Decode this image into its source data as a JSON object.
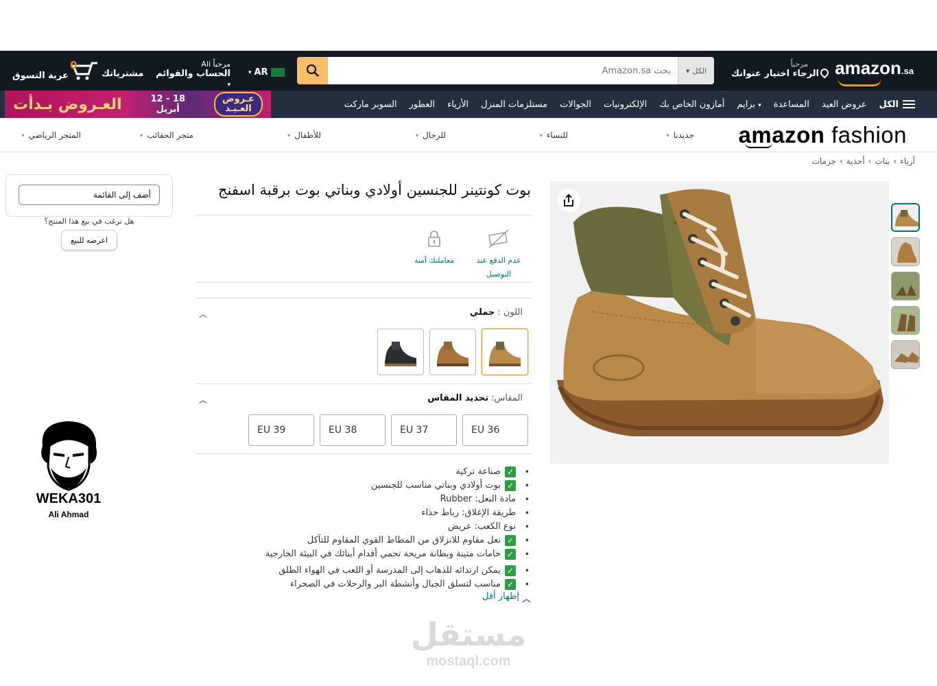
{
  "header": {
    "logo_text": "amazon",
    "logo_suffix": ".sa",
    "deliver_line1": "مرحباً",
    "deliver_line2": "الرجاء اختيار عنوانك",
    "search_category": "الكل",
    "search_placeholder": "بحث Amazon.sa",
    "language": "AR",
    "account_line1": "مرحباً Ali",
    "account_line2": "الحساب والقوائم",
    "orders": "مشترياتك",
    "cart_count": "0",
    "cart_label": "عربة التسوق"
  },
  "nav": {
    "all": "الكل",
    "items": [
      "عروض العيد",
      "المساعدة",
      "برايم",
      "أمازون الخاص بك",
      "الإلكترونيات",
      "الجوالات",
      "مستلزمات المنزل",
      "الأزياء",
      "العطور",
      "السوبر ماركت"
    ],
    "promo_badge_line1": "عـروض",
    "promo_badge_line2": "العـيـد",
    "promo_dates_line1": "12 - 18",
    "promo_dates_line2": "أبريل",
    "promo_title": "العـروض بـدأت"
  },
  "fashion": {
    "logo_bold": "amazon",
    "logo_rest": " fashion",
    "menu": [
      "جديدنا",
      "للنساء",
      "للرجال",
      "للأطفال",
      "متجر الحقائب",
      "المتجر الرياضي"
    ]
  },
  "breadcrumb": [
    "أزياء",
    "›",
    "بنات",
    "›",
    "أحذية",
    "›",
    "جزمات"
  ],
  "product": {
    "title": "بوت كونتينر للجنسين أولادي وبناتي بوت برقبة اسفنج",
    "features": [
      {
        "label": "عدم الدفع عند التوصيل",
        "icon": "no-cash-icon"
      },
      {
        "label": "معاملتك آمنة",
        "icon": "lock-icon"
      }
    ],
    "color_key": "اللون :",
    "color_value": "جملي",
    "swatches": [
      "camel",
      "brown",
      "black"
    ],
    "size_key": "المقاس:",
    "size_value": "تحديد المقاس",
    "sizes": [
      "EU 36",
      "EU 37",
      "EU 38",
      "EU 39"
    ],
    "bullets": [
      {
        "text": "صناعة تركية",
        "check": true
      },
      {
        "text": "بوت أولادي وبناتي مناسب للجنسين",
        "check": true
      },
      {
        "text": "مادة النعل: Rubber",
        "check": false
      },
      {
        "text": "طريقة الإغلاق: رباط حذاء",
        "check": false
      },
      {
        "text": "نوع الكعب: عريض",
        "check": false
      },
      {
        "text": "نعل مقاوم للانزلاق من المطاط القوي المقاوم للتآكل",
        "check": true
      },
      {
        "text": "خامات متينة وبطانة مريحة تحمي أقدام أبنائك في البيئة الخارجية",
        "check": true
      },
      {
        "text": "يمكن ارتدائه للذهاب إلى المدرسة أو اللعب في الهواء الطلق",
        "check": true
      },
      {
        "text": "مناسب لتسلق الجبال وأنشطة البر والرحلات في الصحراء",
        "check": true
      }
    ],
    "show_less": "إظهار أقل"
  },
  "sidebar": {
    "add_to_list": "أضف إلى القائمة",
    "sell_question": "هل ترغب في بيع هذا المنتج؟",
    "sell_button": "اعرضه للبيع"
  },
  "watermark": {
    "name": "WEKA301",
    "sub": "Ali Ahmad",
    "site_ar": "مستقل",
    "site_en": "mostaql.com"
  },
  "colors": {
    "header_bg": "#131921",
    "nav_bg": "#232f3e",
    "accent": "#febd69",
    "link": "#007185",
    "check": "#2e9e44"
  }
}
